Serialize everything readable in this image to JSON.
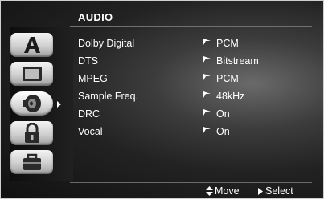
{
  "menu": {
    "title": "AUDIO",
    "tabs": [
      {
        "name": "language",
        "icon": "letter-a-icon"
      },
      {
        "name": "display",
        "icon": "tv-screen-icon"
      },
      {
        "name": "audio",
        "icon": "speaker-icon",
        "selected": true
      },
      {
        "name": "lock",
        "icon": "padlock-icon"
      },
      {
        "name": "others",
        "icon": "briefcase-icon"
      }
    ],
    "settings": [
      {
        "label": "Dolby Digital",
        "value": "PCM"
      },
      {
        "label": "DTS",
        "value": "Bitstream"
      },
      {
        "label": "MPEG",
        "value": "PCM"
      },
      {
        "label": "Sample Freq.",
        "value": "48kHz"
      },
      {
        "label": "DRC",
        "value": "On"
      },
      {
        "label": "Vocal",
        "value": "On"
      }
    ]
  },
  "help": {
    "move_label": "Move",
    "select_label": "Select"
  },
  "colors": {
    "text": "#ffffff",
    "background": "#222222",
    "tab_face": "#cfcfcf"
  }
}
